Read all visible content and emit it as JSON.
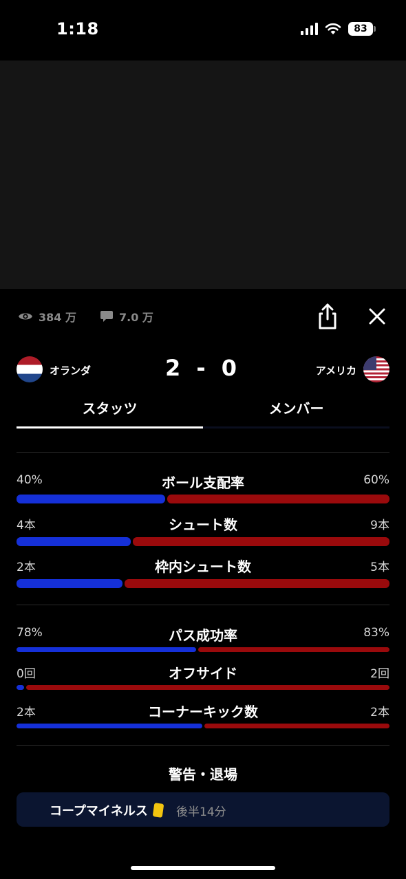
{
  "status_bar": {
    "time": "1:18",
    "battery": "83"
  },
  "meta": {
    "views": "384 万",
    "comments": "7.0 万"
  },
  "match": {
    "home_team": "オランダ",
    "away_team": "アメリカ",
    "score": "2 - 0"
  },
  "tabs": [
    {
      "label": "スタッツ",
      "active": true
    },
    {
      "label": "メンバー",
      "active": false
    }
  ],
  "stats": [
    {
      "label": "ボール支配率",
      "home": "40%",
      "away": "60%",
      "home_share": 0.4
    },
    {
      "label": "シュート数",
      "home": "4本",
      "away": "9本",
      "home_share": 0.3077
    },
    {
      "label": "枠内シュート数",
      "home": "2本",
      "away": "5本",
      "home_share": 0.2857
    },
    {
      "label": "パス成功率",
      "home": "78%",
      "away": "83%",
      "home_share": 0.4845
    },
    {
      "label": "オフサイド",
      "home": "0回",
      "away": "2回",
      "home_share": 0.02
    },
    {
      "label": "コーナーキック数",
      "home": "2本",
      "away": "2本",
      "home_share": 0.5
    }
  ],
  "cards_section": {
    "title": "警告・退場",
    "entries": [
      {
        "player": "コープマイネルス",
        "card": "yellow-card",
        "time": "後半14分"
      }
    ]
  },
  "colors": {
    "home_bar": "#1530d8",
    "away_bar": "#9a0a0c",
    "card_bg": "#0b1530",
    "yellow_card": "#f2c40f"
  }
}
